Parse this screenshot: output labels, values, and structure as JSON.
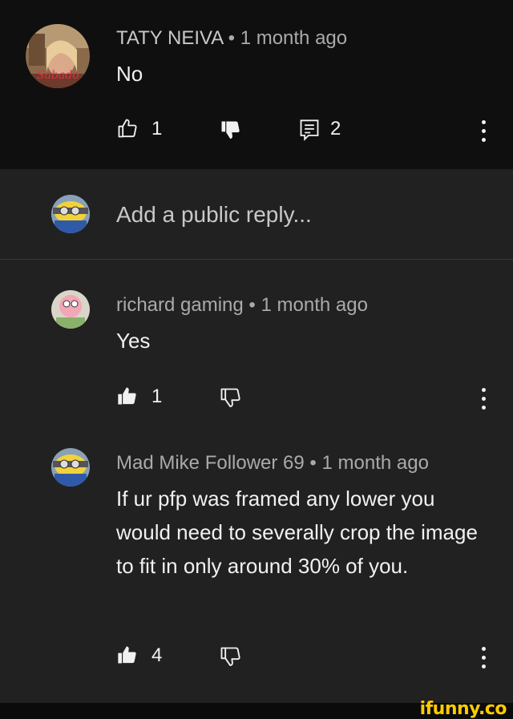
{
  "comment": {
    "author": "TATY NEIVA",
    "time": "1 month ago",
    "text": "No",
    "likes": "1",
    "replies": "2",
    "avatar_caption": "Sabado"
  },
  "reply_box": {
    "placeholder": "Add a public reply..."
  },
  "replies": [
    {
      "author": "richard gaming",
      "time": "1 month ago",
      "text": "Yes",
      "likes": "1"
    },
    {
      "author": "Mad Mike Follower 69",
      "time": "1 month ago",
      "text": "If ur pfp was framed any lower you would need to severally crop the image to fit in only around 30% of you.",
      "likes": "4"
    }
  ],
  "watermark": "ifunny.co",
  "separator": " • ",
  "colors": {
    "background": "#212121",
    "top_background": "#0f0f0f",
    "text": "#f1f1f1",
    "meta": "#aaaaaa",
    "watermark": "#ffcc00"
  },
  "icons": [
    "thumbs-up-icon",
    "thumbs-down-icon",
    "comment-icon",
    "more-vert-icon"
  ]
}
